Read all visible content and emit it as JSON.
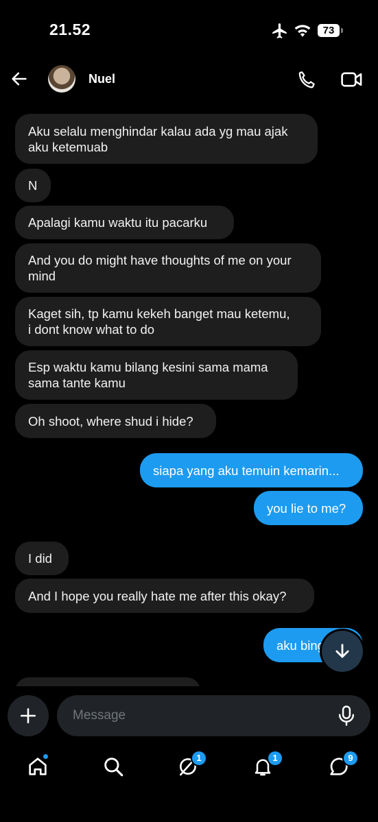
{
  "status_bar": {
    "time": "21.52",
    "battery": "73"
  },
  "header": {
    "contact_name": "Nuel"
  },
  "messages": [
    {
      "dir": "in",
      "lines": [
        "Aku selalu menghindar kalau ada yg mau ajak",
        "aku ketemuab"
      ]
    },
    {
      "dir": "in",
      "lines": [
        "N"
      ]
    },
    {
      "dir": "in",
      "lines": [
        "Apalagi kamu waktu itu pacarku"
      ]
    },
    {
      "dir": "in",
      "lines": [
        "And you do might have thoughts of me on your",
        "mind"
      ]
    },
    {
      "dir": "in",
      "lines": [
        "Kaget sih, tp kamu kekeh banget mau ketemu,",
        "i dont know what to do"
      ]
    },
    {
      "dir": "in",
      "lines": [
        "Esp waktu kamu bilang kesini sama mama",
        "sama tante kamu"
      ]
    },
    {
      "dir": "in",
      "lines": [
        "Oh shoot, where shud i hide?"
      ]
    },
    {
      "dir": "out",
      "lines": [
        "siapa yang aku temuin kemarin..."
      ]
    },
    {
      "dir": "out",
      "lines": [
        "you lie to me?"
      ]
    },
    {
      "dir": "in",
      "lines": [
        "I did"
      ]
    },
    {
      "dir": "in",
      "lines": [
        "And I hope you really hate me after this okay?"
      ]
    },
    {
      "dir": "out",
      "lines": [
        "aku bing"
      ]
    }
  ],
  "composer": {
    "placeholder": "Message"
  },
  "bottom_nav": {
    "home_dot": true,
    "grok_badge": "1",
    "notifications_badge": "1",
    "messages_badge": "9"
  },
  "colors": {
    "accent": "#1d9bf0",
    "incoming_bubble": "#1e1e1e",
    "background": "#000000"
  }
}
